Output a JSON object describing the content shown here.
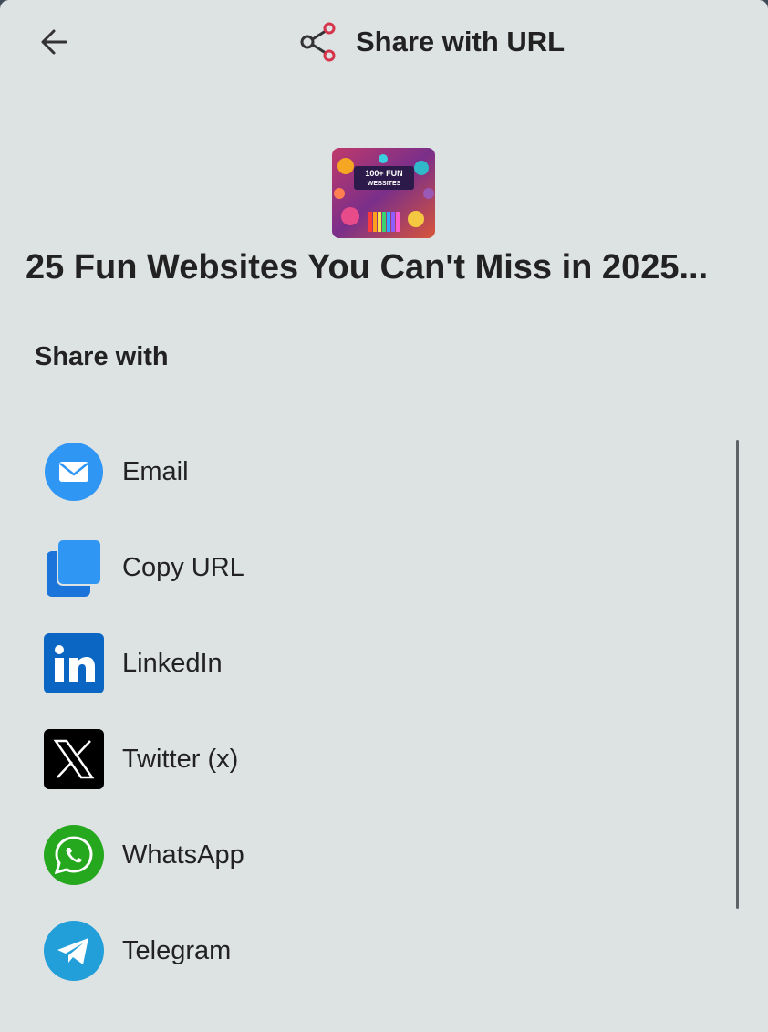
{
  "header": {
    "back_icon": "arrow-left-icon",
    "share_icon": "share-icon",
    "title": "Share with URL",
    "accent_color": "#d6344a"
  },
  "post": {
    "thumbnail_text": "100+ FUN WEBSITES",
    "title": "25 Fun Websites You Can't Miss in 2025..."
  },
  "share_section": {
    "heading": "Share with"
  },
  "share_options": [
    {
      "label": "Email",
      "icon": "email-icon",
      "color": "#2f96f3"
    },
    {
      "label": "Copy URL",
      "icon": "copy-icon",
      "color": "#2f96f3"
    },
    {
      "label": "LinkedIn",
      "icon": "linkedin-icon",
      "color": "#0a66c2"
    },
    {
      "label": "Twitter (x)",
      "icon": "x-twitter-icon",
      "color": "#000000"
    },
    {
      "label": "WhatsApp",
      "icon": "whatsapp-icon",
      "color": "#25a71e"
    },
    {
      "label": "Telegram",
      "icon": "telegram-icon",
      "color": "#229ed9"
    }
  ]
}
